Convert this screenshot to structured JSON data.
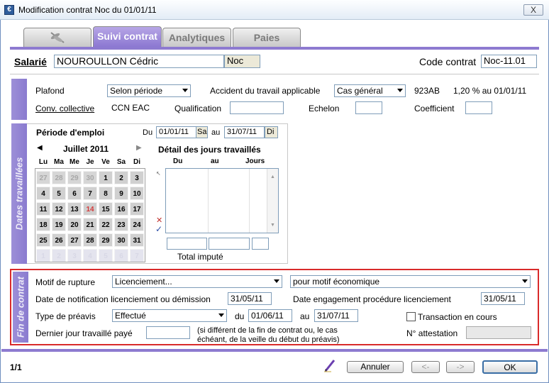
{
  "window": {
    "title": "Modification contrat Noc du 01/01/11",
    "close": "X",
    "app_icon": "€"
  },
  "tabs": [
    {
      "label": "",
      "icon": "dragonfly-icon"
    },
    {
      "label": "Suivi contrat",
      "active": true
    },
    {
      "label": "Analytiques"
    },
    {
      "label": "Paies"
    }
  ],
  "header": {
    "salarie_label": "Salarié",
    "salarie_name": "NOUROULLON Cédric",
    "salarie_code": "Noc",
    "code_contrat_label": "Code contrat",
    "code_contrat_value": "Noc-11.01"
  },
  "plafond": {
    "label": "Plafond",
    "value": "Selon période",
    "accident_label": "Accident du travail applicable",
    "accident_value": "Cas général",
    "code": "923AB",
    "rate": "1,20 % au 01/01/11",
    "conv_label": "Conv. collective",
    "conv_value": "CCN EAC",
    "qualification_label": "Qualification",
    "qualification_value": "",
    "echelon_label": "Echelon",
    "echelon_value": "",
    "coefficient_label": "Coefficient",
    "coefficient_value": ""
  },
  "dates": {
    "section_label": "Dates travaillées",
    "periode_label": "Période d'emploi",
    "du_label": "Du",
    "du_value": "01/01/11",
    "du_day": "Sa",
    "au_label": "au",
    "au_value": "31/07/11",
    "au_day": "Di",
    "calendar": {
      "month": "Juillet 2011",
      "prev": "◀",
      "next": "▶",
      "weekdays": [
        "Lu",
        "Ma",
        "Me",
        "Je",
        "Ve",
        "Sa",
        "Di"
      ],
      "weeks": [
        [
          "27",
          "28",
          "29",
          "30",
          "1",
          "2",
          "3"
        ],
        [
          "4",
          "5",
          "6",
          "7",
          "8",
          "9",
          "10"
        ],
        [
          "11",
          "12",
          "13",
          "14",
          "15",
          "16",
          "17"
        ],
        [
          "18",
          "19",
          "20",
          "21",
          "22",
          "23",
          "24"
        ],
        [
          "25",
          "26",
          "27",
          "28",
          "29",
          "30",
          "31"
        ],
        [
          "1",
          "2",
          "3",
          "4",
          "5",
          "6",
          "7"
        ]
      ]
    },
    "detail": {
      "title": "Détail des jours travaillés",
      "col_du": "Du",
      "col_au": "au",
      "col_jours": "Jours",
      "total_label": "Total imputé"
    }
  },
  "fin": {
    "section_label": "Fin de contrat",
    "motif_label": "Motif de rupture",
    "motif_value": "Licenciement...",
    "motif_detail": "pour motif économique",
    "notif_label": "Date de notification licenciement ou démission",
    "notif_value": "31/05/11",
    "engagement_label": "Date engagement procédure licenciement",
    "engagement_value": "31/05/11",
    "preavis_label": "Type de préavis",
    "preavis_value": "Effectué",
    "du_label": "du",
    "du_value": "01/06/11",
    "au_label": "au",
    "au_value": "31/07/11",
    "transaction_label": "Transaction en cours",
    "dernier_label": "Dernier jour travaillé payé",
    "dernier_value": "",
    "dernier_note_1": "(si différent de la fin de contrat ou, le cas",
    "dernier_note_2": "échéant, de la veille du début du préavis)",
    "attestation_label": "N° attestation",
    "attestation_value": ""
  },
  "footer": {
    "page": "1/1",
    "annuler": "Annuler",
    "prev": "<-",
    "next": "->",
    "ok": "OK"
  }
}
